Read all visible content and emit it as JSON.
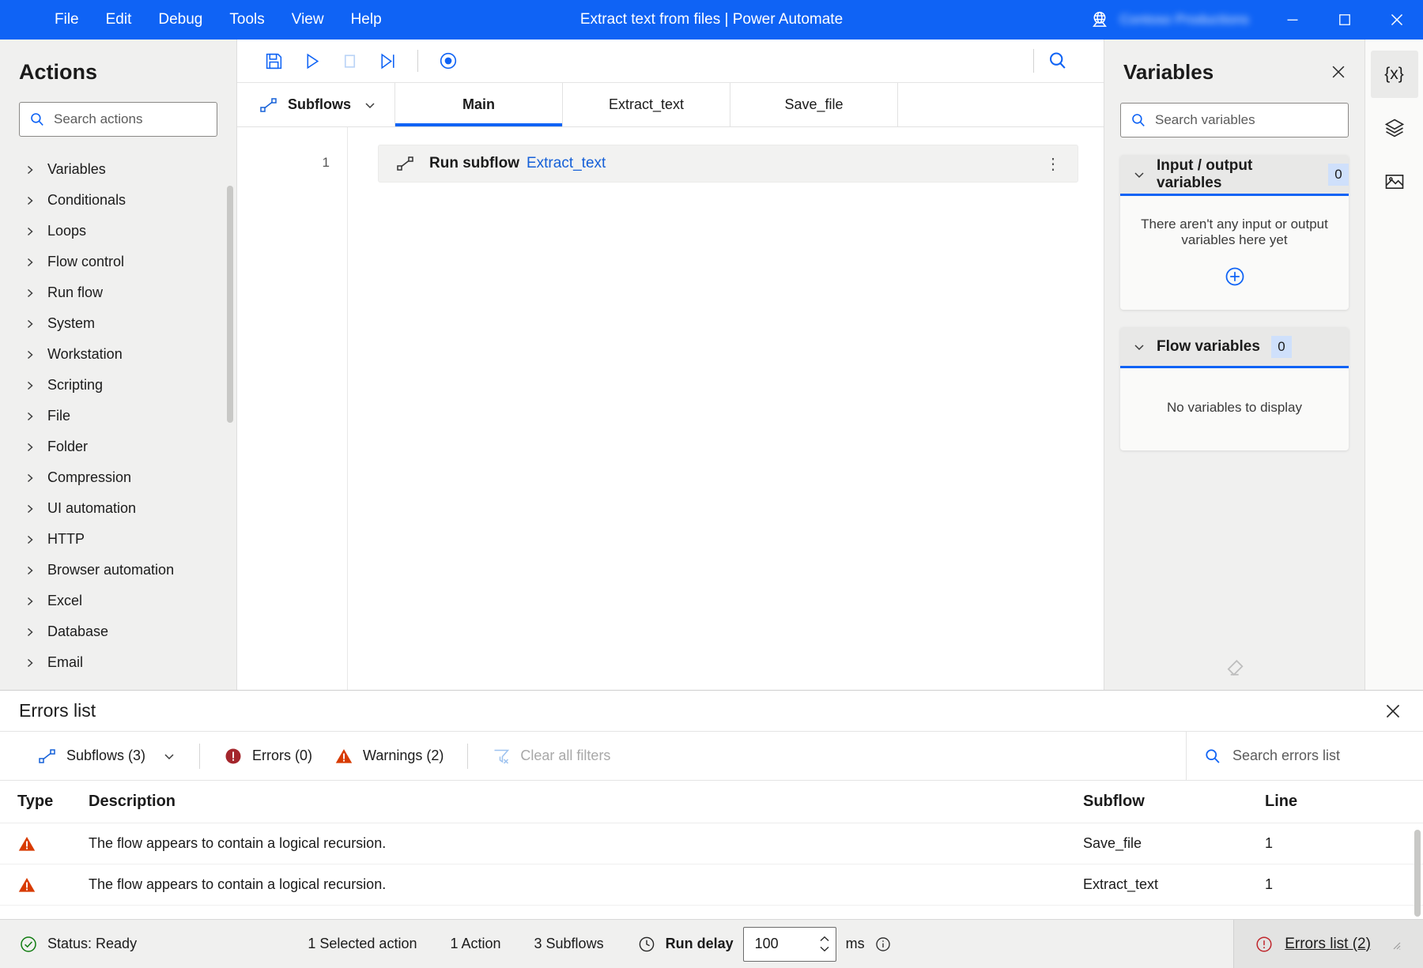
{
  "window": {
    "title": "Extract text from files | Power Automate",
    "tenant_name": "Contoso Productions",
    "menus": [
      "File",
      "Edit",
      "Debug",
      "Tools",
      "View",
      "Help"
    ],
    "controls": {
      "minimize": "Minimize",
      "maximize": "Maximize",
      "close": "Close"
    }
  },
  "actions_pane": {
    "title": "Actions",
    "search_placeholder": "Search actions",
    "groups": [
      "Variables",
      "Conditionals",
      "Loops",
      "Flow control",
      "Run flow",
      "System",
      "Workstation",
      "Scripting",
      "File",
      "Folder",
      "Compression",
      "UI automation",
      "HTTP",
      "Browser automation",
      "Excel",
      "Database",
      "Email"
    ]
  },
  "toolbar": {
    "save": "Save",
    "run": "Run",
    "stop": "Stop",
    "run_next_action": "Run next action",
    "record": "Recorder",
    "search": "Search"
  },
  "tabs": {
    "subflows_label": "Subflows",
    "items": [
      {
        "label": "Main",
        "active": true
      },
      {
        "label": "Extract_text",
        "active": false
      },
      {
        "label": "Save_file",
        "active": false
      }
    ]
  },
  "canvas": {
    "line_numbers": [
      "1"
    ],
    "steps": [
      {
        "line": "1",
        "title": "Run subflow",
        "argument": "Extract_text",
        "more": "⋮"
      }
    ]
  },
  "variables_pane": {
    "title": "Variables",
    "search_placeholder": "Search variables",
    "sections": [
      {
        "title": "Input / output variables",
        "count": "0",
        "empty_text": "There aren't any input or output variables here yet",
        "has_add": true
      },
      {
        "title": "Flow variables",
        "count": "0",
        "empty_text": "No variables to display",
        "has_add": false
      }
    ]
  },
  "rail": {
    "items": [
      {
        "name": "variables",
        "label": "{x}",
        "active": true
      },
      {
        "name": "ui-elements",
        "label": "",
        "active": false
      },
      {
        "name": "images",
        "label": "",
        "active": false
      }
    ]
  },
  "errors_panel": {
    "title": "Errors list",
    "filters": {
      "subflows": "Subflows (3)",
      "errors": "Errors (0)",
      "warnings": "Warnings (2)",
      "clear_filters": "Clear all filters"
    },
    "search_placeholder": "Search errors list",
    "columns": [
      "Type",
      "Description",
      "Subflow",
      "Line"
    ],
    "rows": [
      {
        "type": "warning",
        "description": "The flow appears to contain a logical recursion.",
        "subflow": "Save_file",
        "line": "1"
      },
      {
        "type": "warning",
        "description": "The flow appears to contain a logical recursion.",
        "subflow": "Extract_text",
        "line": "1"
      }
    ]
  },
  "statusbar": {
    "status": "Status: Ready",
    "selected_action": "1 Selected action",
    "action_count": "1 Action",
    "subflow_count": "3 Subflows",
    "run_delay_label": "Run delay",
    "run_delay_value": "100",
    "run_delay_unit": "ms",
    "errors_link": "Errors list (2)"
  },
  "colors": {
    "brand_blue": "#0F63F5",
    "link_blue": "#1560D8",
    "warning_orange": "#D83B01",
    "error_red": "#A4262C",
    "success_green": "#107C10",
    "badge_bg": "#CFE0FB"
  }
}
